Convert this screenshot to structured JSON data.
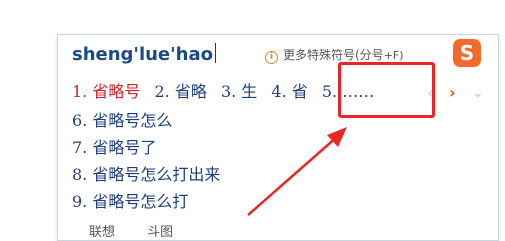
{
  "ime": {
    "composition": "sheng'lue'hao",
    "hint_icon": "info-icon",
    "hint_text": "更多特殊符号(分号",
    "hint_key": "+F)",
    "logo_glyph": "S",
    "candidates": [
      {
        "num": "1.",
        "text": "省略号",
        "selected": true
      },
      {
        "num": "2.",
        "text": "省略"
      },
      {
        "num": "3.",
        "text": "生"
      },
      {
        "num": "4.",
        "text": "省"
      },
      {
        "num": "5.",
        "text": "……"
      }
    ],
    "nav_prev": "‹",
    "nav_next": "›",
    "nav_expand": "⌄",
    "more_candidates": [
      "6. 省略号怎么",
      "7. 省略号了",
      "8. 省略号怎么打出来",
      "9. 省略号怎么打"
    ],
    "footer": [
      "联想",
      "斗图"
    ]
  },
  "colors": {
    "selected_candidate": "#c8282b",
    "candidate": "#1f3f7a",
    "annotation_red": "#ea2525",
    "logo_orange": "#f26b2a"
  }
}
